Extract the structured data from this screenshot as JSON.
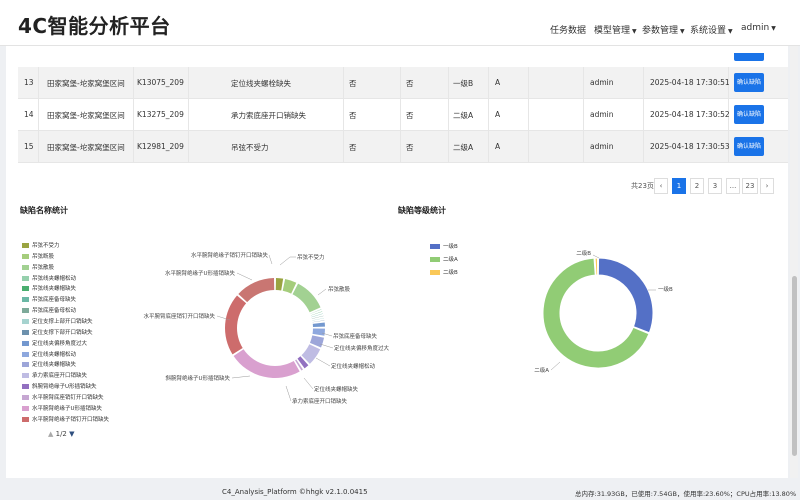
{
  "navbar": {
    "brand": "4C智能分析平台",
    "items": [
      {
        "label": "任务数据",
        "caret": false
      },
      {
        "label": "模型管理",
        "caret": true
      },
      {
        "label": "参数管理",
        "caret": true
      },
      {
        "label": "系统设置",
        "caret": true
      },
      {
        "label": "admin",
        "caret": true
      }
    ]
  },
  "table": {
    "rows": [
      {
        "no": "13",
        "section": "田家窝堡-坨家窝堡区间",
        "code": "K13075_209",
        "defect": "定位线夹螺栓缺失",
        "f1": "否",
        "f2": "否",
        "level": "一级B",
        "grade": "A",
        "user": "admin",
        "time": "2025-04-18 17:30:51",
        "action": "确认缺陷"
      },
      {
        "no": "14",
        "section": "田家窝堡-坨家窝堡区间",
        "code": "K13275_209",
        "defect": "承力索底座开口销缺失",
        "f1": "否",
        "f2": "否",
        "level": "二级A",
        "grade": "A",
        "user": "admin",
        "time": "2025-04-18 17:30:52",
        "action": "确认缺陷"
      },
      {
        "no": "15",
        "section": "田家窝堡-坨家窝堡区间",
        "code": "K12981_209",
        "defect": "吊弦不受力",
        "f1": "否",
        "f2": "否",
        "level": "二级A",
        "grade": "A",
        "user": "admin",
        "time": "2025-04-18 17:30:53",
        "action": "确认缺陷"
      }
    ]
  },
  "pagination": {
    "total_text": "共23页",
    "prev": "‹",
    "pages": [
      "1",
      "2",
      "3",
      "...",
      "23"
    ],
    "next": "›"
  },
  "defect_chart_title": "缺陷名称统计",
  "level_chart_title": "缺陷等级统计",
  "legend_pager": {
    "up": "▲",
    "text": "1/2",
    "down": "▼"
  },
  "chart_data": [
    {
      "type": "pie",
      "title": "缺陷名称统计",
      "donut": true,
      "legend_position": "left",
      "labels": [
        "吊弦不受力",
        "吊弦断股",
        "吊弦散股",
        "吊弦线夹螺帽松动",
        "吊弦线夹螺帽缺失",
        "吊弦底座备母缺失",
        "吊弦底座备母松动",
        "定位支撑上部开口销缺失",
        "定位支撑下部开口销缺失",
        "定位线夹偏移角度过大",
        "定位线夹螺帽松动",
        "定位线夹螺帽缺失",
        "承力索底座开口销缺失",
        "斜腕臂绝缘子U形插销缺失",
        "水平腕臂底座销钉开口销缺失",
        "水平腕臂绝缘子U形插销缺失",
        "水平腕臂绝缘子销钉开口销缺失"
      ],
      "values": [
        1.2,
        1.8,
        4.6,
        0.3,
        0.3,
        0.3,
        0.3,
        0.3,
        0.3,
        0.8,
        1.2,
        1.6,
        2.6,
        0.9,
        0.5,
        10.0,
        8.5,
        5.5
      ],
      "colors": [
        "#9aa441",
        "#a5cd7c",
        "#a2d192",
        "#96d0ad",
        "#4aae6f",
        "#6bb8a5",
        "#7eaa9a",
        "#a6d3cf",
        "#6d91ad",
        "#7398cf",
        "#8ea8de",
        "#9da6d9",
        "#bfbce3",
        "#9270c0",
        "#c6a7d2",
        "#d9a0cf",
        "#cd6c6c",
        "#c97672"
      ],
      "slice_labels": [
        "吊弦不受力",
        "吊弦散股",
        "吊弦底座备母缺失",
        "定位线夹偏移角度过大",
        "定位线夹螺帽松动",
        "定位线夹螺帽缺失",
        "承力索底座开口销缺失",
        "斜腕臂绝缘子U形插销缺失",
        "水平腕臂底座销钉开口销缺失",
        "水平腕臂绝缘子U形插销缺失",
        "水平腕臂绝缘子销钉开口销缺失"
      ]
    },
    {
      "type": "pie",
      "title": "缺陷等级统计",
      "donut": true,
      "legend_position": "left",
      "labels": [
        "一级B",
        "二级A",
        "二级B"
      ],
      "values": [
        31,
        68,
        1
      ],
      "colors": [
        "#5470c6",
        "#91cc75",
        "#fac858"
      ]
    }
  ],
  "footer": {
    "center": "C4_Analysis_Platform ©hhgk v2.1.0.0415",
    "right": "总内存:31.93GB，已使用:7.54GB，使用率:23.60%；CPU占用率:13.80%"
  }
}
